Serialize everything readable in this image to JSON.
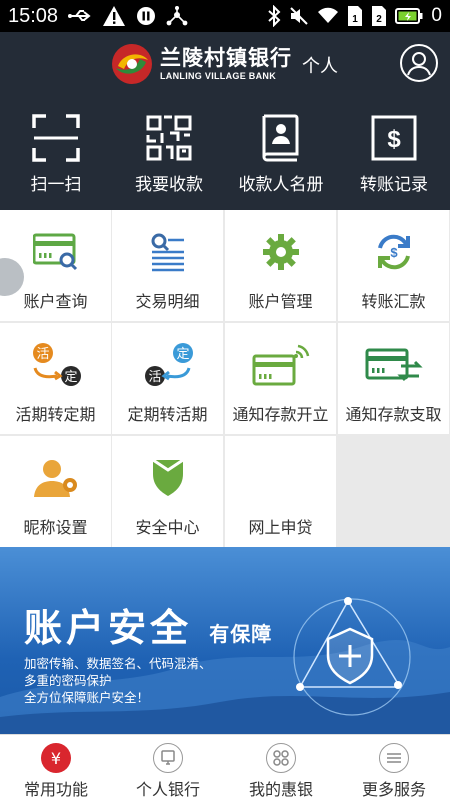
{
  "status": {
    "time": "15:08",
    "battery_level": "0"
  },
  "header": {
    "bank_name_cn": "兰陵村镇银行",
    "bank_name_en": "LANLING VILLAGE BANK",
    "mode": "个人"
  },
  "quick_actions": [
    {
      "label": "扫一扫",
      "icon": "scan-icon"
    },
    {
      "label": "我要收款",
      "icon": "qr-code-icon"
    },
    {
      "label": "收款人名册",
      "icon": "contacts-book-icon"
    },
    {
      "label": "转账记录",
      "icon": "transfer-record-icon"
    }
  ],
  "grid": [
    {
      "label": "账户查询",
      "icon": "account-query-icon"
    },
    {
      "label": "交易明细",
      "icon": "transaction-detail-icon"
    },
    {
      "label": "账户管理",
      "icon": "gear-icon"
    },
    {
      "label": "转账汇款",
      "icon": "transfer-icon"
    },
    {
      "label": "活期转定期",
      "icon": "current-to-fixed-icon",
      "badge_a": "活",
      "badge_b": "定"
    },
    {
      "label": "定期转活期",
      "icon": "fixed-to-current-icon",
      "badge_a": "活",
      "badge_b": "定"
    },
    {
      "label": "通知存款开立",
      "icon": "notice-deposit-open-icon"
    },
    {
      "label": "通知存款支取",
      "icon": "notice-deposit-withdraw-icon"
    },
    {
      "label": "昵称设置",
      "icon": "nickname-settings-icon"
    },
    {
      "label": "安全中心",
      "icon": "shield-icon"
    },
    {
      "label": "网上申贷",
      "icon": ""
    }
  ],
  "banner": {
    "title": "账户安全",
    "title_small": "有保障",
    "lines": [
      "加密传输、数据签名、代码混淆、",
      "多重的密码保护",
      "全方位保障账户安全！"
    ]
  },
  "tabs": [
    {
      "label": "常用功能",
      "active": true,
      "icon": "yen-icon",
      "icon_text": "¥"
    },
    {
      "label": "个人银行",
      "active": false,
      "icon": "personal-bank-icon"
    },
    {
      "label": "我的惠银",
      "active": false,
      "icon": "apps-icon"
    },
    {
      "label": "更多服务",
      "active": false,
      "icon": "more-services-icon"
    }
  ],
  "colors": {
    "header_bg": "#242c37",
    "accent_green": "#6aaa3f",
    "accent_blue": "#3a7bc8",
    "tab_active": "#d9262e"
  }
}
